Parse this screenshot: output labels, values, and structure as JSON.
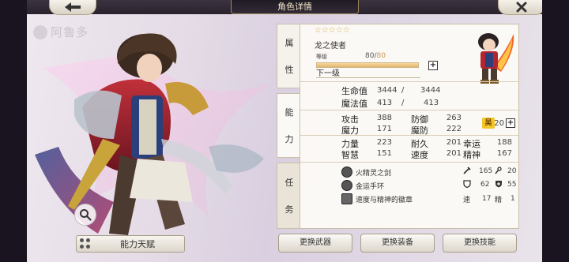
{
  "header": {
    "title": "角色详情"
  },
  "watermark": {
    "text": "阿鲁多"
  },
  "left": {
    "talent_button": "能力天赋"
  },
  "tabs": {
    "attributes": [
      "属",
      "性"
    ],
    "ability": [
      "能",
      "力"
    ],
    "task": [
      "任",
      "务"
    ]
  },
  "character": {
    "stars": "☆☆☆☆☆",
    "name": "龙之使者",
    "level_label": "等级",
    "level": "80",
    "level_max": "80",
    "level_progress": 1.0,
    "next_level": "下一级"
  },
  "vitals": {
    "hp_label": "生命值",
    "hp_current": "3444",
    "hp_max": "3444",
    "mp_label": "魔法值",
    "mp_current": "413",
    "mp_max": "413",
    "slash": "/"
  },
  "stats": {
    "attack_label": "攻击",
    "attack": "388",
    "defense_label": "防御",
    "defense": "263",
    "magic_label": "魔力",
    "magic": "171",
    "mdef_label": "魔防",
    "mdef": "222",
    "strength_label": "力量",
    "strength": "223",
    "endurance_label": "耐久",
    "endurance": "201",
    "luck_label": "幸运",
    "luck": "188",
    "intellect_label": "智慧",
    "intellect": "151",
    "speed_label": "速度",
    "speed": "201",
    "spirit_label": "精神",
    "spirit": "167",
    "points_badge": "吴",
    "points": "20"
  },
  "equipment": {
    "weapon": "火精灵之剑",
    "armor": "金运手环",
    "accessory": "速度与精神的徽章",
    "weapon_atk": "165",
    "weapon_val2": "20",
    "armor_def": "62",
    "armor_val2": "55",
    "acc_speed_label": "速",
    "acc_speed": "17",
    "acc_spirit_label": "精",
    "acc_spirit": "1"
  },
  "buttons": {
    "change_weapon": "更换武器",
    "change_equipment": "更换装备",
    "change_skill": "更换技能"
  },
  "colors": {
    "accent_gold": "#d4b24a",
    "badge_yellow": "#f2c629",
    "header_dark": "#2a232e"
  }
}
